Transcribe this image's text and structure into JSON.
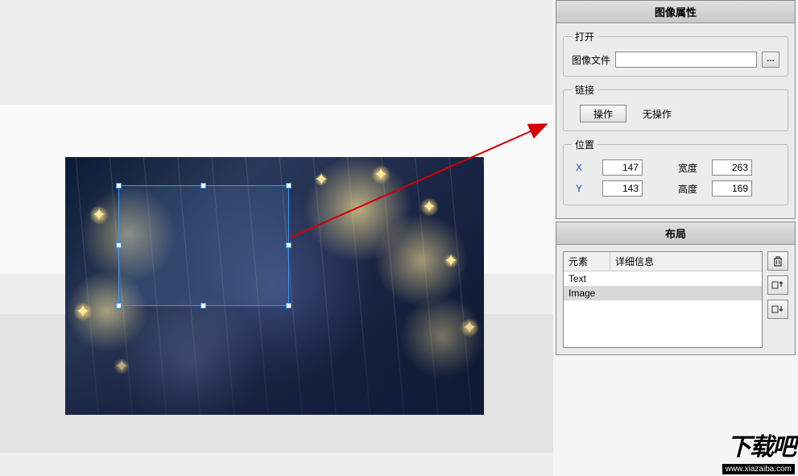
{
  "panels": {
    "image_properties": {
      "title": "图像属性",
      "open": {
        "legend": "打开",
        "file_label": "图像文件",
        "file_value": "",
        "browse_label": "…"
      },
      "link": {
        "legend": "链接",
        "action_button": "操作",
        "status": "无操作"
      },
      "position": {
        "legend": "位置",
        "x_label": "X",
        "x_value": "147",
        "y_label": "Y",
        "y_value": "143",
        "width_label": "宽度",
        "width_value": "263",
        "height_label": "高度",
        "height_value": "169"
      }
    },
    "layout": {
      "title": "布局",
      "columns": {
        "element": "元素",
        "detail": "详细信息"
      },
      "rows": [
        {
          "element": "Text",
          "detail": "",
          "selected": false
        },
        {
          "element": "Image",
          "detail": "",
          "selected": true
        }
      ]
    }
  },
  "watermark": {
    "text": "下载吧",
    "url": "www.xiazaiba.com"
  }
}
